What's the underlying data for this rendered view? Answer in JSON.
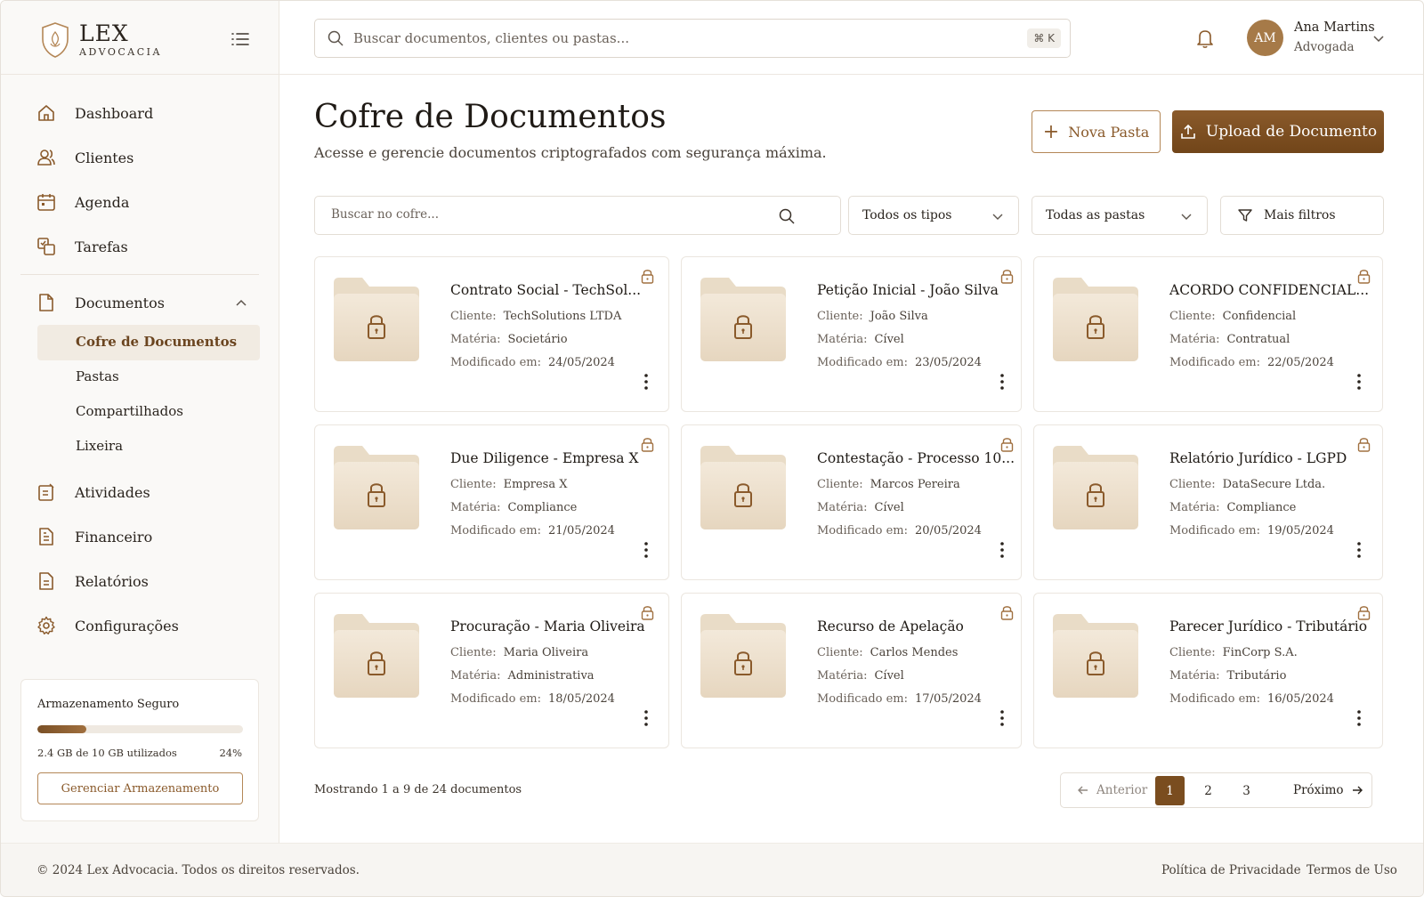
{
  "brand": {
    "name": "LEX",
    "subtitle": "ADVOCACIA"
  },
  "sidebar": {
    "items": [
      {
        "label": "Dashboard",
        "icon": "home-icon"
      },
      {
        "label": "Clientes",
        "icon": "users-icon"
      },
      {
        "label": "Agenda",
        "icon": "calendar-icon"
      },
      {
        "label": "Tarefas",
        "icon": "tasks-icon"
      },
      {
        "label": "Documentos",
        "icon": "document-icon",
        "expanded": true
      },
      {
        "label": "Atividades",
        "icon": "activity-icon"
      },
      {
        "label": "Financeiro",
        "icon": "finance-icon"
      },
      {
        "label": "Relatórios",
        "icon": "report-icon"
      },
      {
        "label": "Configurações",
        "icon": "gear-icon"
      }
    ],
    "sub_items": [
      {
        "label": "Cofre de Documentos",
        "active": true
      },
      {
        "label": "Pastas"
      },
      {
        "label": "Compartilhados"
      },
      {
        "label": "Lixeira"
      }
    ],
    "storage": {
      "title": "Armazenamento Seguro",
      "used_text": "2.4 GB de 10 GB utilizados",
      "percent_text": "24%",
      "percent": 24,
      "button": "Gerenciar Armazenamento"
    }
  },
  "header": {
    "search_placeholder": "Buscar documentos, clientes ou pastas...",
    "shortcut": "⌘ K",
    "user": {
      "initials": "AM",
      "name": "Ana Martins",
      "role": "Advogada"
    }
  },
  "page": {
    "title": "Cofre de Documentos",
    "subtitle": "Acesse e gerencie documentos criptografados com segurança máxima.",
    "new_folder": "Nova Pasta",
    "upload": "Upload de Documento"
  },
  "filters": {
    "search_placeholder": "Buscar no cofre...",
    "type": "Todos os tipos",
    "folder": "Todas as pastas",
    "more": "Mais filtros"
  },
  "labels": {
    "client": "Cliente:",
    "matter": "Matéria:",
    "modified": "Modificado em:"
  },
  "documents": [
    {
      "title": "Contrato Social - TechSol...",
      "client": "TechSolutions LTDA",
      "matter": "Societário",
      "modified": "24/05/2024"
    },
    {
      "title": "Petição Inicial - João Silva",
      "client": "João Silva",
      "matter": "Cível",
      "modified": "23/05/2024"
    },
    {
      "title": "ACORDO CONFIDENCIAL...",
      "client": "Confidencial",
      "matter": "Contratual",
      "modified": "22/05/2024"
    },
    {
      "title": "Due Diligence - Empresa X",
      "client": "Empresa X",
      "matter": "Compliance",
      "modified": "21/05/2024"
    },
    {
      "title": "Contestação - Processo 10...",
      "client": "Marcos Pereira",
      "matter": "Cível",
      "modified": "20/05/2024"
    },
    {
      "title": "Relatório Jurídico - LGPD",
      "client": "DataSecure Ltda.",
      "matter": "Compliance",
      "modified": "19/05/2024"
    },
    {
      "title": "Procuração - Maria Oliveira",
      "client": "Maria Oliveira",
      "matter": "Administrativa",
      "modified": "18/05/2024"
    },
    {
      "title": "Recurso de Apelação",
      "client": "Carlos Mendes",
      "matter": "Cível",
      "modified": "17/05/2024"
    },
    {
      "title": "Parecer Jurídico - Tributário",
      "client": "FinCorp S.A.",
      "matter": "Tributário",
      "modified": "16/05/2024"
    }
  ],
  "pagination": {
    "showing": "Mostrando 1 a 9 de 24 documentos",
    "prev": "Anterior",
    "next": "Próximo",
    "pages": [
      "1",
      "2",
      "3"
    ],
    "current": "1"
  },
  "footer": {
    "copyright": "© 2024 Lex Advocacia. Todos os direitos reservados.",
    "privacy": "Política de Privacidade",
    "terms": "Termos de Uso"
  },
  "colors": {
    "accent": "#7a4d1f",
    "accent_light": "#b48757",
    "folder": "#efe3d0",
    "background": "#faf9f7"
  }
}
